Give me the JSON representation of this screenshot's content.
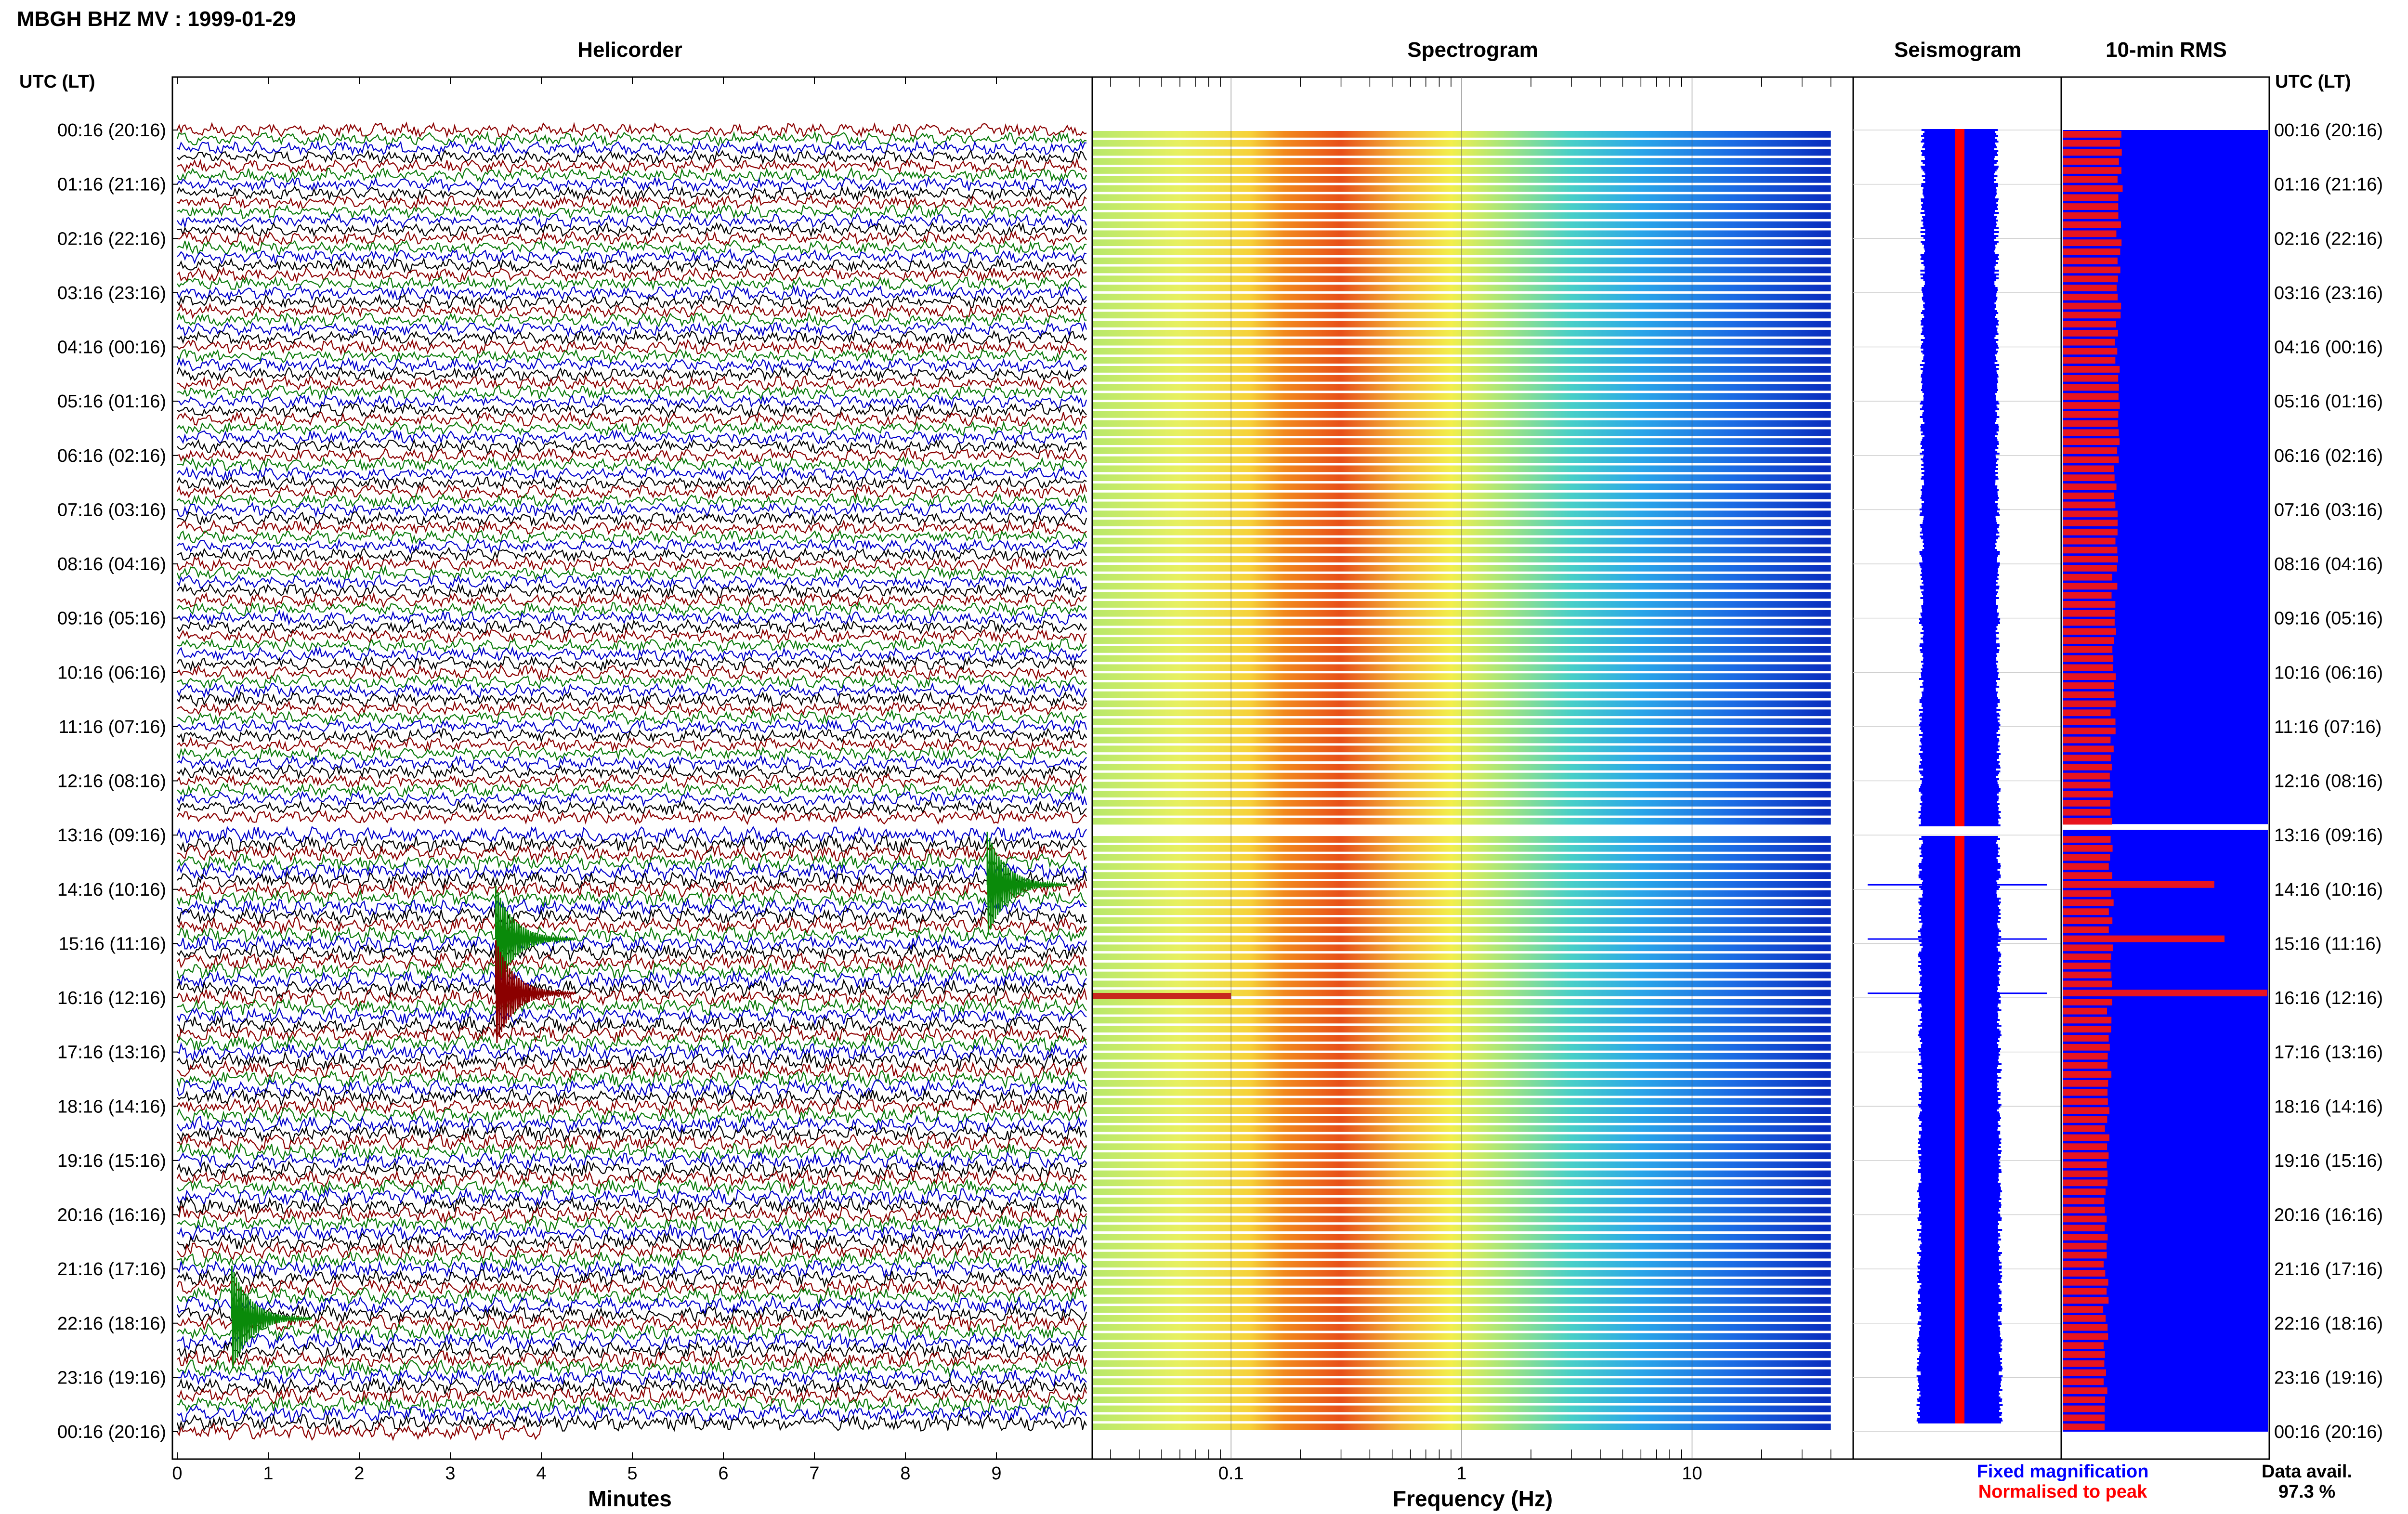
{
  "header": {
    "title": "MBGH BHZ MV : 1999-01-29",
    "left_axis_label": "UTC (LT)",
    "right_axis_label": "UTC (LT)"
  },
  "colors": {
    "trace_cycle": [
      "#000000",
      "#8b0000",
      "#0a7a0a",
      "#0000cc"
    ],
    "seismogram_fixed": "#0000ff",
    "seismogram_normalised": "#ff0000",
    "rms_fixed": "#0000ff",
    "rms_normalised": "#e8141e"
  },
  "chart_data": [
    {
      "type": "line",
      "title": "Helicorder",
      "xlabel": "Minutes",
      "xlim": [
        0,
        10
      ],
      "x_ticks": [
        "0",
        "1",
        "2",
        "3",
        "4",
        "5",
        "6",
        "7",
        "8",
        "9"
      ],
      "y_ticks": [
        "00:16 (20:16)",
        "01:16 (21:16)",
        "02:16 (22:16)",
        "03:16 (23:16)",
        "04:16 (00:16)",
        "05:16 (01:16)",
        "06:16 (02:16)",
        "07:16 (03:16)",
        "08:16 (04:16)",
        "09:16 (05:16)",
        "10:16 (06:16)",
        "11:16 (07:16)",
        "12:16 (08:16)",
        "13:16 (09:16)",
        "14:16 (10:16)",
        "15:16 (11:16)",
        "16:16 (12:16)",
        "17:16 (13:16)",
        "18:16 (14:16)",
        "19:16 (15:16)",
        "20:16 (16:16)",
        "21:16 (17:16)",
        "22:16 (18:16)",
        "23:16 (19:16)",
        "00:16 (20:16)"
      ],
      "rows": 144,
      "row_minutes": 10,
      "gap_after_hour": "12:16 (08:16)",
      "last_row_end_minutes": 4,
      "events": [
        {
          "time": "15:16 (11:16)",
          "minute": 3.5,
          "color": "green"
        },
        {
          "time": "16:16 (12:16)",
          "minute": 3.5,
          "color": "dark-red"
        },
        {
          "time": "14:16 (10:16)",
          "minute": 8.9,
          "color": "green"
        },
        {
          "time": "22:16 (18:16)",
          "minute": 0.6,
          "color": "green"
        }
      ]
    },
    {
      "type": "heatmap",
      "title": "Spectrogram",
      "xlabel": "Frequency (Hz)",
      "x_scale": "log",
      "xlim": [
        0.025,
        50
      ],
      "x_ticks": [
        "0.1",
        "1",
        "10"
      ],
      "colormap": "jet",
      "peak_band_hz": [
        0.16,
        0.5
      ],
      "max_frequency_hz": 40
    },
    {
      "type": "line",
      "title": "Seismogram",
      "series": [
        {
          "name": "Fixed magnification",
          "color": "#0000ff"
        },
        {
          "name": "Normalised to peak",
          "color": "#ff0000"
        }
      ]
    },
    {
      "type": "bar",
      "title": "10-min RMS",
      "series": [
        {
          "name": "Fixed magnification",
          "color": "#0000ff"
        },
        {
          "name": "Normalised to peak",
          "color": "#e8141e"
        }
      ],
      "bars": 144,
      "spikes": [
        {
          "time": "14:16 (10:16)",
          "relative": 0.74
        },
        {
          "time": "15:16 (11:16)",
          "relative": 0.79
        },
        {
          "time": "16:16 (12:16)",
          "relative": 1.0
        }
      ]
    }
  ],
  "legend": {
    "fixed_magnification": "Fixed magnification",
    "normalised_to_peak": "Normalised to peak"
  },
  "availability": {
    "label": "Data avail.",
    "value": "97.3 %"
  }
}
